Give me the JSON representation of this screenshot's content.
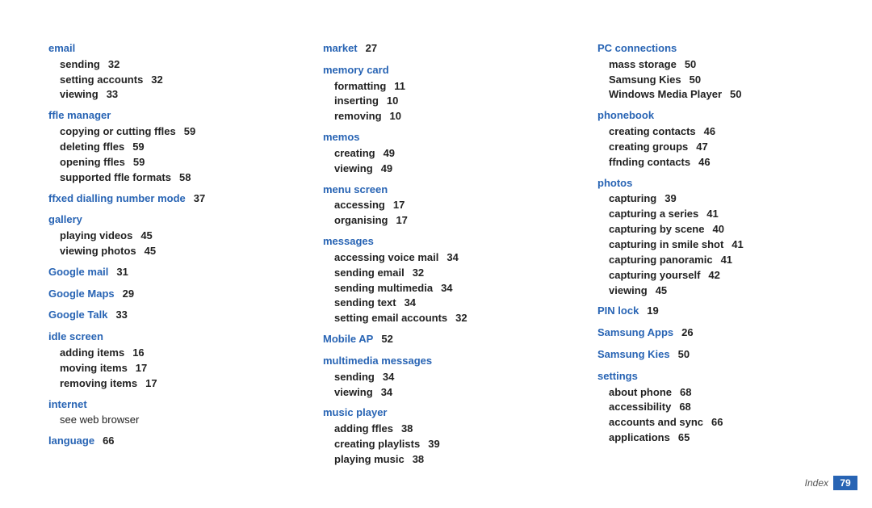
{
  "footer": {
    "label": "Index",
    "page": "79"
  },
  "columns": [
    [
      {
        "type": "section",
        "title": "email",
        "subs": [
          {
            "t": "sending",
            "p": "32"
          },
          {
            "t": "setting accounts",
            "p": "32"
          },
          {
            "t": "viewing",
            "p": "33"
          }
        ]
      },
      {
        "type": "section",
        "title": "ffle manager",
        "subs": [
          {
            "t": "copying or cutting ffles",
            "p": "59"
          },
          {
            "t": "deleting ffles",
            "p": "59"
          },
          {
            "t": "opening ffles",
            "p": "59"
          },
          {
            "t": "supported ffle formats",
            "p": "58"
          }
        ]
      },
      {
        "type": "head",
        "title": "ffxed dialling number mode",
        "page": "37"
      },
      {
        "type": "section",
        "title": "gallery",
        "subs": [
          {
            "t": "playing videos",
            "p": "45"
          },
          {
            "t": "viewing photos",
            "p": "45"
          }
        ]
      },
      {
        "type": "head",
        "title": "Google mail",
        "page": "31"
      },
      {
        "type": "head",
        "title": "Google Maps",
        "page": "29"
      },
      {
        "type": "head",
        "title": "Google Talk",
        "page": "33"
      },
      {
        "type": "section",
        "title": "idle screen",
        "subs": [
          {
            "t": "adding items",
            "p": "16"
          },
          {
            "t": "moving items",
            "p": "17"
          },
          {
            "t": "removing items",
            "p": "17"
          }
        ]
      },
      {
        "type": "section",
        "title": "internet",
        "note": "see web browser"
      },
      {
        "type": "head",
        "title": "language",
        "page": "66"
      }
    ],
    [
      {
        "type": "head",
        "title": "market",
        "page": "27"
      },
      {
        "type": "section",
        "title": "memory card",
        "subs": [
          {
            "t": "formatting",
            "p": "11"
          },
          {
            "t": "inserting",
            "p": "10"
          },
          {
            "t": "removing",
            "p": "10"
          }
        ]
      },
      {
        "type": "section",
        "title": "memos",
        "subs": [
          {
            "t": "creating",
            "p": "49"
          },
          {
            "t": "viewing",
            "p": "49"
          }
        ]
      },
      {
        "type": "section",
        "title": "menu screen",
        "subs": [
          {
            "t": "accessing",
            "p": "17"
          },
          {
            "t": "organising",
            "p": "17"
          }
        ]
      },
      {
        "type": "section",
        "title": "messages",
        "subs": [
          {
            "t": "accessing voice mail",
            "p": "34"
          },
          {
            "t": "sending email",
            "p": "32"
          },
          {
            "t": "sending multimedia",
            "p": "34"
          },
          {
            "t": "sending text",
            "p": "34"
          },
          {
            "t": "setting email accounts",
            "p": "32"
          }
        ]
      },
      {
        "type": "head",
        "title": "Mobile AP",
        "page": "52"
      },
      {
        "type": "section",
        "title": "multimedia messages",
        "subs": [
          {
            "t": "sending",
            "p": "34"
          },
          {
            "t": "viewing",
            "p": "34"
          }
        ]
      },
      {
        "type": "section",
        "title": "music player",
        "subs": [
          {
            "t": "adding ffles",
            "p": "38"
          },
          {
            "t": "creating playlists",
            "p": "39"
          },
          {
            "t": "playing music",
            "p": "38"
          }
        ]
      }
    ],
    [
      {
        "type": "section",
        "title": "PC connections",
        "subs": [
          {
            "t": "mass storage",
            "p": "50"
          },
          {
            "t": "Samsung Kies",
            "p": "50"
          },
          {
            "t": "Windows Media Player",
            "p": "50"
          }
        ]
      },
      {
        "type": "section",
        "title": "phonebook",
        "subs": [
          {
            "t": "creating contacts",
            "p": "46"
          },
          {
            "t": "creating groups",
            "p": "47"
          },
          {
            "t": "ffnding contacts",
            "p": "46"
          }
        ]
      },
      {
        "type": "section",
        "title": "photos",
        "subs": [
          {
            "t": "capturing",
            "p": "39"
          },
          {
            "t": "capturing a series",
            "p": "41"
          },
          {
            "t": "capturing by scene",
            "p": "40"
          },
          {
            "t": "capturing in smile shot",
            "p": "41"
          },
          {
            "t": "capturing panoramic",
            "p": "41"
          },
          {
            "t": "capturing yourself",
            "p": "42"
          },
          {
            "t": "viewing",
            "p": "45"
          }
        ]
      },
      {
        "type": "head",
        "title": "PIN lock",
        "page": "19"
      },
      {
        "type": "head",
        "title": "Samsung Apps",
        "page": "26"
      },
      {
        "type": "head",
        "title": "Samsung Kies",
        "page": "50"
      },
      {
        "type": "section",
        "title": "settings",
        "subs": [
          {
            "t": "about phone",
            "p": "68"
          },
          {
            "t": "accessibility",
            "p": "68"
          },
          {
            "t": "accounts and sync",
            "p": "66"
          },
          {
            "t": "applications",
            "p": "65"
          }
        ]
      }
    ]
  ]
}
